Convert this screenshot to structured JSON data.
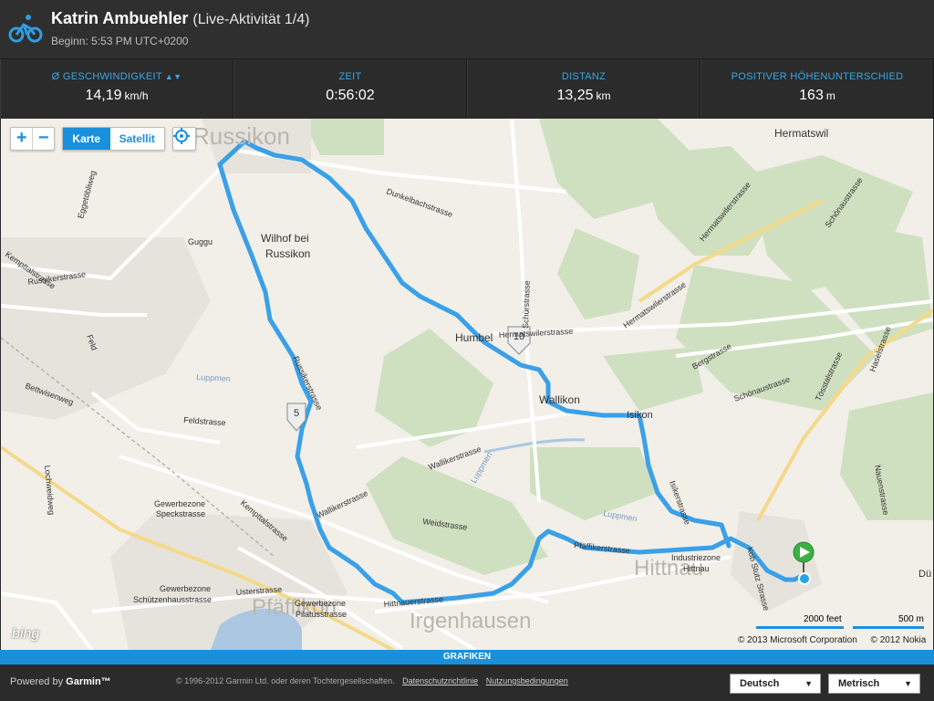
{
  "activity": {
    "athlete": "Katrin Ambuehler",
    "label": "(Live-Aktivität 1/4)",
    "start": "Beginn: 5:53 PM UTC+0200",
    "sport_icon": "bicycle-icon"
  },
  "stats": [
    {
      "label": "Ø GESCHWINDIGKEIT",
      "value": "14,19",
      "unit": "km/h",
      "sortable": true
    },
    {
      "label": "ZEIT",
      "value": "0:56:02",
      "unit": ""
    },
    {
      "label": "DISTANZ",
      "value": "13,25",
      "unit": "km"
    },
    {
      "label": "POSITIVER HÖHENUNTERSCHIED",
      "value": "163",
      "unit": "m"
    }
  ],
  "map": {
    "controls": {
      "zoom_in": "+",
      "zoom_out": "−",
      "map_label": "Karte",
      "satellite_label": "Satellit",
      "active_type": "Karte"
    },
    "place_labels": {
      "russikon": "Russikon",
      "hermatswil": "Hermatswil",
      "wilhof1": "Wilhof bei",
      "wilhof2": "Russikon",
      "humbel": "Humbel",
      "wallikon": "Wallikon",
      "isikon": "Isikon",
      "hittnau": "Hittnau",
      "pfaffikon": "Pfäffikon",
      "irgenhausen": "Irgenhausen",
      "gewerbe1a": "Gewerbezone",
      "gewerbe1b": "Speckstrasse",
      "gewerbe2a": "Gewerbezone",
      "gewerbe2b": "Schützenhausstrasse",
      "gewerbe3a": "Gewerbezone",
      "gewerbe3b": "Pilatusstrasse",
      "industrie1": "Industriezone",
      "industrie2": "Hittnau",
      "guggu": "Guggu",
      "feld": "Feld"
    },
    "street_labels": {
      "egg": "Eggetöbliweg",
      "russikerstrasse": "Russikerstrasse",
      "kempttal": "Kempttalstrasse",
      "kempttal2": "Kempttalstrasse",
      "dunkelbach": "Dunkelbachstrasse",
      "schur": "Schürstrasse",
      "hermatswiler": "Hermatswilerstrasse",
      "hermatswiler2": "Hermatswilerstrasse",
      "hermatswiler3": "Hermatswilerstrasse",
      "schonau": "Schönaustrasse",
      "schonau2": "Schönaustrasse",
      "tosstal": "Tösstalstrasse",
      "haselstrasse": "Haselstrasse",
      "nauen": "Nauenstrasse",
      "berg": "Bergstrasse",
      "bettwisen": "Bettwisenweg",
      "feldstrasse": "Feldstrasse",
      "lochweid": "Lochweidweg",
      "wallikerstrasse": "Wallikerstrasse",
      "wallikerstrasse2": "Wallikerstrasse",
      "weidstrasse": "Weidstrasse",
      "pfaffikerstrasse": "Pfäffikerstrasse",
      "hittnauer": "Hittnauerstrasse",
      "usterstrasse": "Usterstrasse",
      "kob": "Kob Stutz Strasse",
      "luppmen": "Luppmen",
      "luppmen2": "Luppmen",
      "luppmen3": "Luppmen",
      "isikon_str": "Isikerstrasse",
      "russiker2": "Russikerstrasse",
      "dussnang": "Dü"
    },
    "markers": [
      {
        "label": "5"
      },
      {
        "label": "10"
      }
    ],
    "scale": {
      "imperial": "2000 feet",
      "metric": "500 m"
    },
    "copyright": [
      "© 2013 Microsoft Corporation",
      "© 2012 Nokia"
    ],
    "bing_logo": "bing",
    "route_color": "#3aa0e8",
    "start_marker_color": "#3cb043"
  },
  "grafiken_label": "GRAFIKEN",
  "footer": {
    "powered_prefix": "Powered by",
    "brand": "Garmin™",
    "legal": "© 1996-2012 Garmin Ltd. oder deren Tochtergesellschaften.",
    "privacy": "Datenschutzrichtlinie",
    "terms": "Nutzungsbedingungen",
    "language": "Deutsch",
    "units": "Metrisch"
  }
}
